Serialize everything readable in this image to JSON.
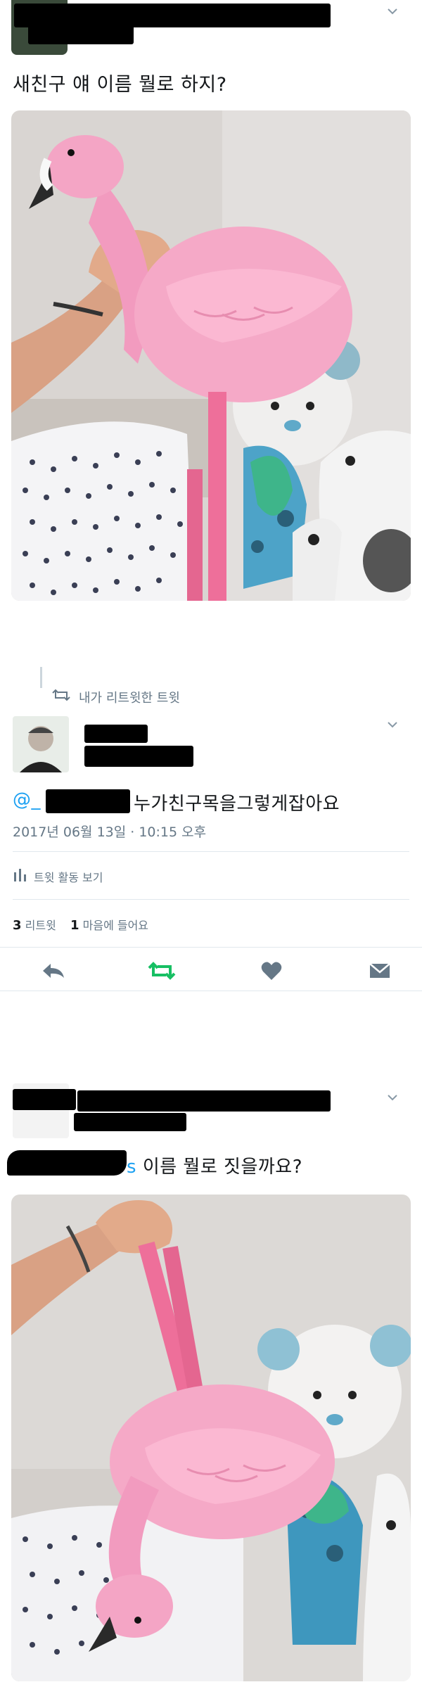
{
  "tweet1": {
    "text": "새친구 얘 이름 뭘로 하지?",
    "chevron": "⌄"
  },
  "retweet_card": {
    "retweet_label": "내가 리트윗한 트윗",
    "handle_prefix": "@_",
    "reply_text": "누가친구목을그렇게잡아요",
    "timestamp": "2017년 06월 13일 · 10:15 오후",
    "activity_label": "트윗 활동 보기",
    "retweets_count": "3",
    "retweets_label": "리트윗",
    "likes_count": "1",
    "likes_label": "마음에 들어요",
    "chevron": "⌄"
  },
  "tweet3": {
    "handle_suffix": "s",
    "text": "이름 뭘로 짓을까요?",
    "chevron": "⌄"
  },
  "colors": {
    "retweet_green": "#17bf63",
    "icon_gray": "#657786",
    "link_blue": "#1da1f2",
    "flamingo_pink": "#f29bbf"
  },
  "icons": [
    "chevron-down-icon",
    "retweet-icon",
    "bar-chart-icon",
    "reply-icon",
    "like-icon",
    "message-icon"
  ]
}
